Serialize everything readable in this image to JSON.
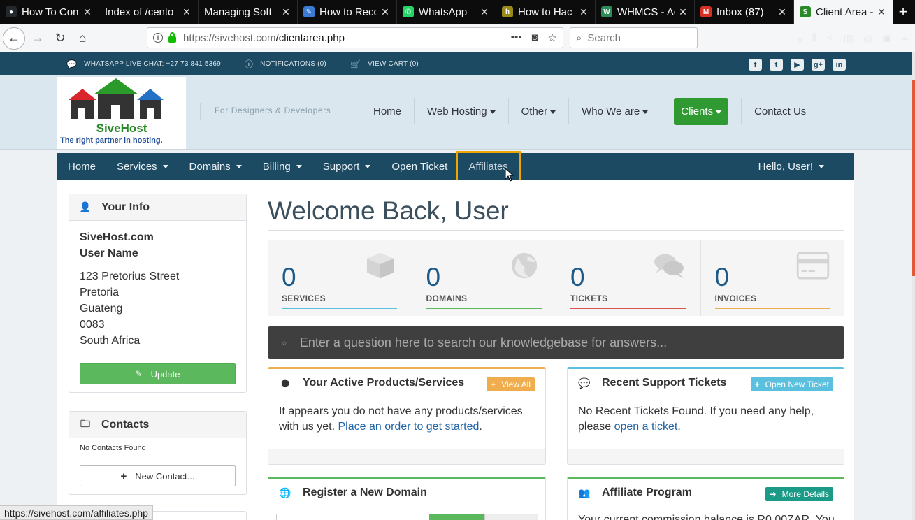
{
  "browser": {
    "tabs": [
      {
        "title": "How To Con",
        "icon": "github-icon",
        "color": "#24292e",
        "glyph": "●"
      },
      {
        "title": "Index of /cento",
        "icon": "none",
        "color": "",
        "glyph": ""
      },
      {
        "title": "Managing Soft",
        "icon": "none",
        "color": "",
        "glyph": ""
      },
      {
        "title": "How to Reco",
        "icon": "edit-icon",
        "color": "#3b7bd4",
        "glyph": "✎"
      },
      {
        "title": "WhatsApp",
        "icon": "whatsapp-icon",
        "color": "#25d366",
        "glyph": "✆"
      },
      {
        "title": "How to Hac",
        "icon": "h-icon",
        "color": "#9a8a1a",
        "glyph": "h"
      },
      {
        "title": "WHMCS - Ac",
        "icon": "whmcs-icon",
        "color": "#2e8b57",
        "glyph": "W"
      },
      {
        "title": "Inbox (87)",
        "icon": "gmail-icon",
        "color": "#d93025",
        "glyph": "M"
      },
      {
        "title": "Client Area -",
        "icon": "sivehost-icon",
        "color": "#2a8a2a",
        "glyph": "S",
        "active": true
      }
    ],
    "new_tab": "+",
    "url_host": "https://sivehost.com",
    "url_path": "/clientarea.php",
    "search_placeholder": "Search",
    "status_url": "https://sivehost.com/affiliates.php"
  },
  "topstrip": {
    "whatsapp": "WHATSAPP LIVE CHAT: +27 73 841 5369",
    "notifications": "NOTIFICATIONS (0)",
    "cart": "VIEW CART (0)",
    "social": [
      "facebook-icon",
      "twitter-icon",
      "youtube-icon",
      "googleplus-icon",
      "linkedin-icon"
    ]
  },
  "header": {
    "brand": "SiveHost",
    "tagline": "The right partner in hosting.",
    "slogan": "For Designers & Developers",
    "nav": [
      "Home",
      "Web Hosting",
      "Other",
      "Who We are",
      "Clients",
      "Contact Us"
    ]
  },
  "clientnav": {
    "items": [
      "Home",
      "Services",
      "Domains",
      "Billing",
      "Support",
      "Open Ticket",
      "Affiliates"
    ],
    "hello": "Hello, User!"
  },
  "sidebar": {
    "info_title": "Your Info",
    "company": "SiveHost.com",
    "name": "User Name",
    "address": [
      "123 Pretorius Street",
      "Pretoria",
      "Guateng",
      "0083",
      "South Africa"
    ],
    "update": "Update",
    "contacts_title": "Contacts",
    "no_contacts": "No Contacts Found",
    "new_contact": "New Contact..."
  },
  "main": {
    "welcome": "Welcome Back, User",
    "stats": [
      {
        "value": "0",
        "label": "SERVICES",
        "color": "#5bc0de"
      },
      {
        "value": "0",
        "label": "DOMAINS",
        "color": "#5cb85c"
      },
      {
        "value": "0",
        "label": "TICKETS",
        "color": "#d9534f"
      },
      {
        "value": "0",
        "label": "INVOICES",
        "color": "#f0ad4e"
      }
    ],
    "kb_placeholder": "Enter a question here to search our knowledgebase for answers...",
    "products": {
      "title": "Your Active Products/Services",
      "button": "View All",
      "text": "It appears you do not have any products/services with us yet.",
      "link": "Place an order to get started",
      "after": "."
    },
    "tickets": {
      "title": "Recent Support Tickets",
      "button": "Open New Ticket",
      "text": "No Recent Tickets Found. If you need any help, please",
      "link": "open a ticket",
      "after": "."
    },
    "domain": {
      "title": "Register a New Domain"
    },
    "affiliate": {
      "title": "Affiliate Program",
      "button": "More Details",
      "text": "Your current commission balance is R0.00ZAR. You"
    }
  }
}
